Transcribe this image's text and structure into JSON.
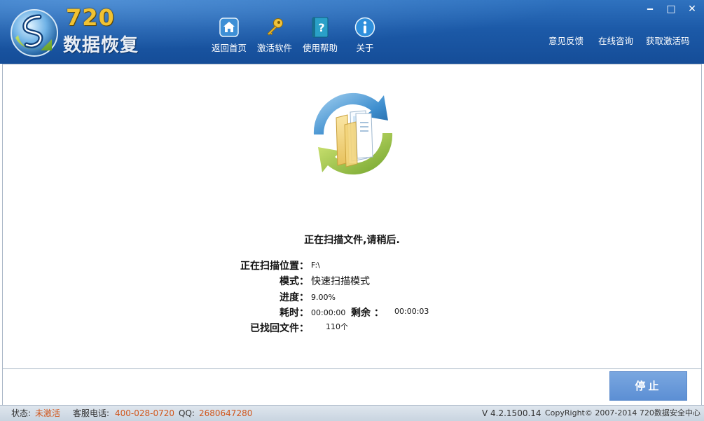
{
  "app": {
    "logo_number": "720",
    "logo_name": "数据恢复"
  },
  "toolbar": {
    "items": [
      {
        "label": "返回首页",
        "icon": "home-icon"
      },
      {
        "label": "激活软件",
        "icon": "key-icon"
      },
      {
        "label": "使用帮助",
        "icon": "help-book-icon"
      },
      {
        "label": "关于",
        "icon": "info-icon"
      }
    ]
  },
  "window_controls": {
    "minimize": "‒",
    "maximize": "□",
    "close": "✕"
  },
  "top_links": [
    "意见反馈",
    "在线咨询",
    "获取激活码"
  ],
  "scan": {
    "title": "正在扫描文件,请稍后.",
    "location_label": "正在扫描位置：",
    "location_value": "F:\\",
    "mode_label": "模式：",
    "mode_value": "快速扫描模式",
    "progress_label": "进度：",
    "progress_value": "9.00%",
    "elapsed_label": "耗时：",
    "elapsed_value": "00:00:00",
    "remaining_label": "剩余 ：",
    "remaining_value": "00:00:03",
    "found_label": "已找回文件：",
    "found_value": "110个"
  },
  "actions": {
    "stop_label": "停止"
  },
  "status_bar": {
    "state_label": "状态:",
    "state_value": "未激活",
    "phone_label": "客服电话:",
    "phone_value": "400-028-0720",
    "qq_label": "QQ:",
    "qq_value": "2680647280",
    "version": "V 4.2.1500.14",
    "copyright": "CopyRight© 2007-2014 720数据安全中心"
  },
  "colors": {
    "header_blue": "#1c5aa8",
    "logo_gold": "#f1c232",
    "accent_orange": "#d0561c",
    "button_blue": "#6b9ad9"
  }
}
